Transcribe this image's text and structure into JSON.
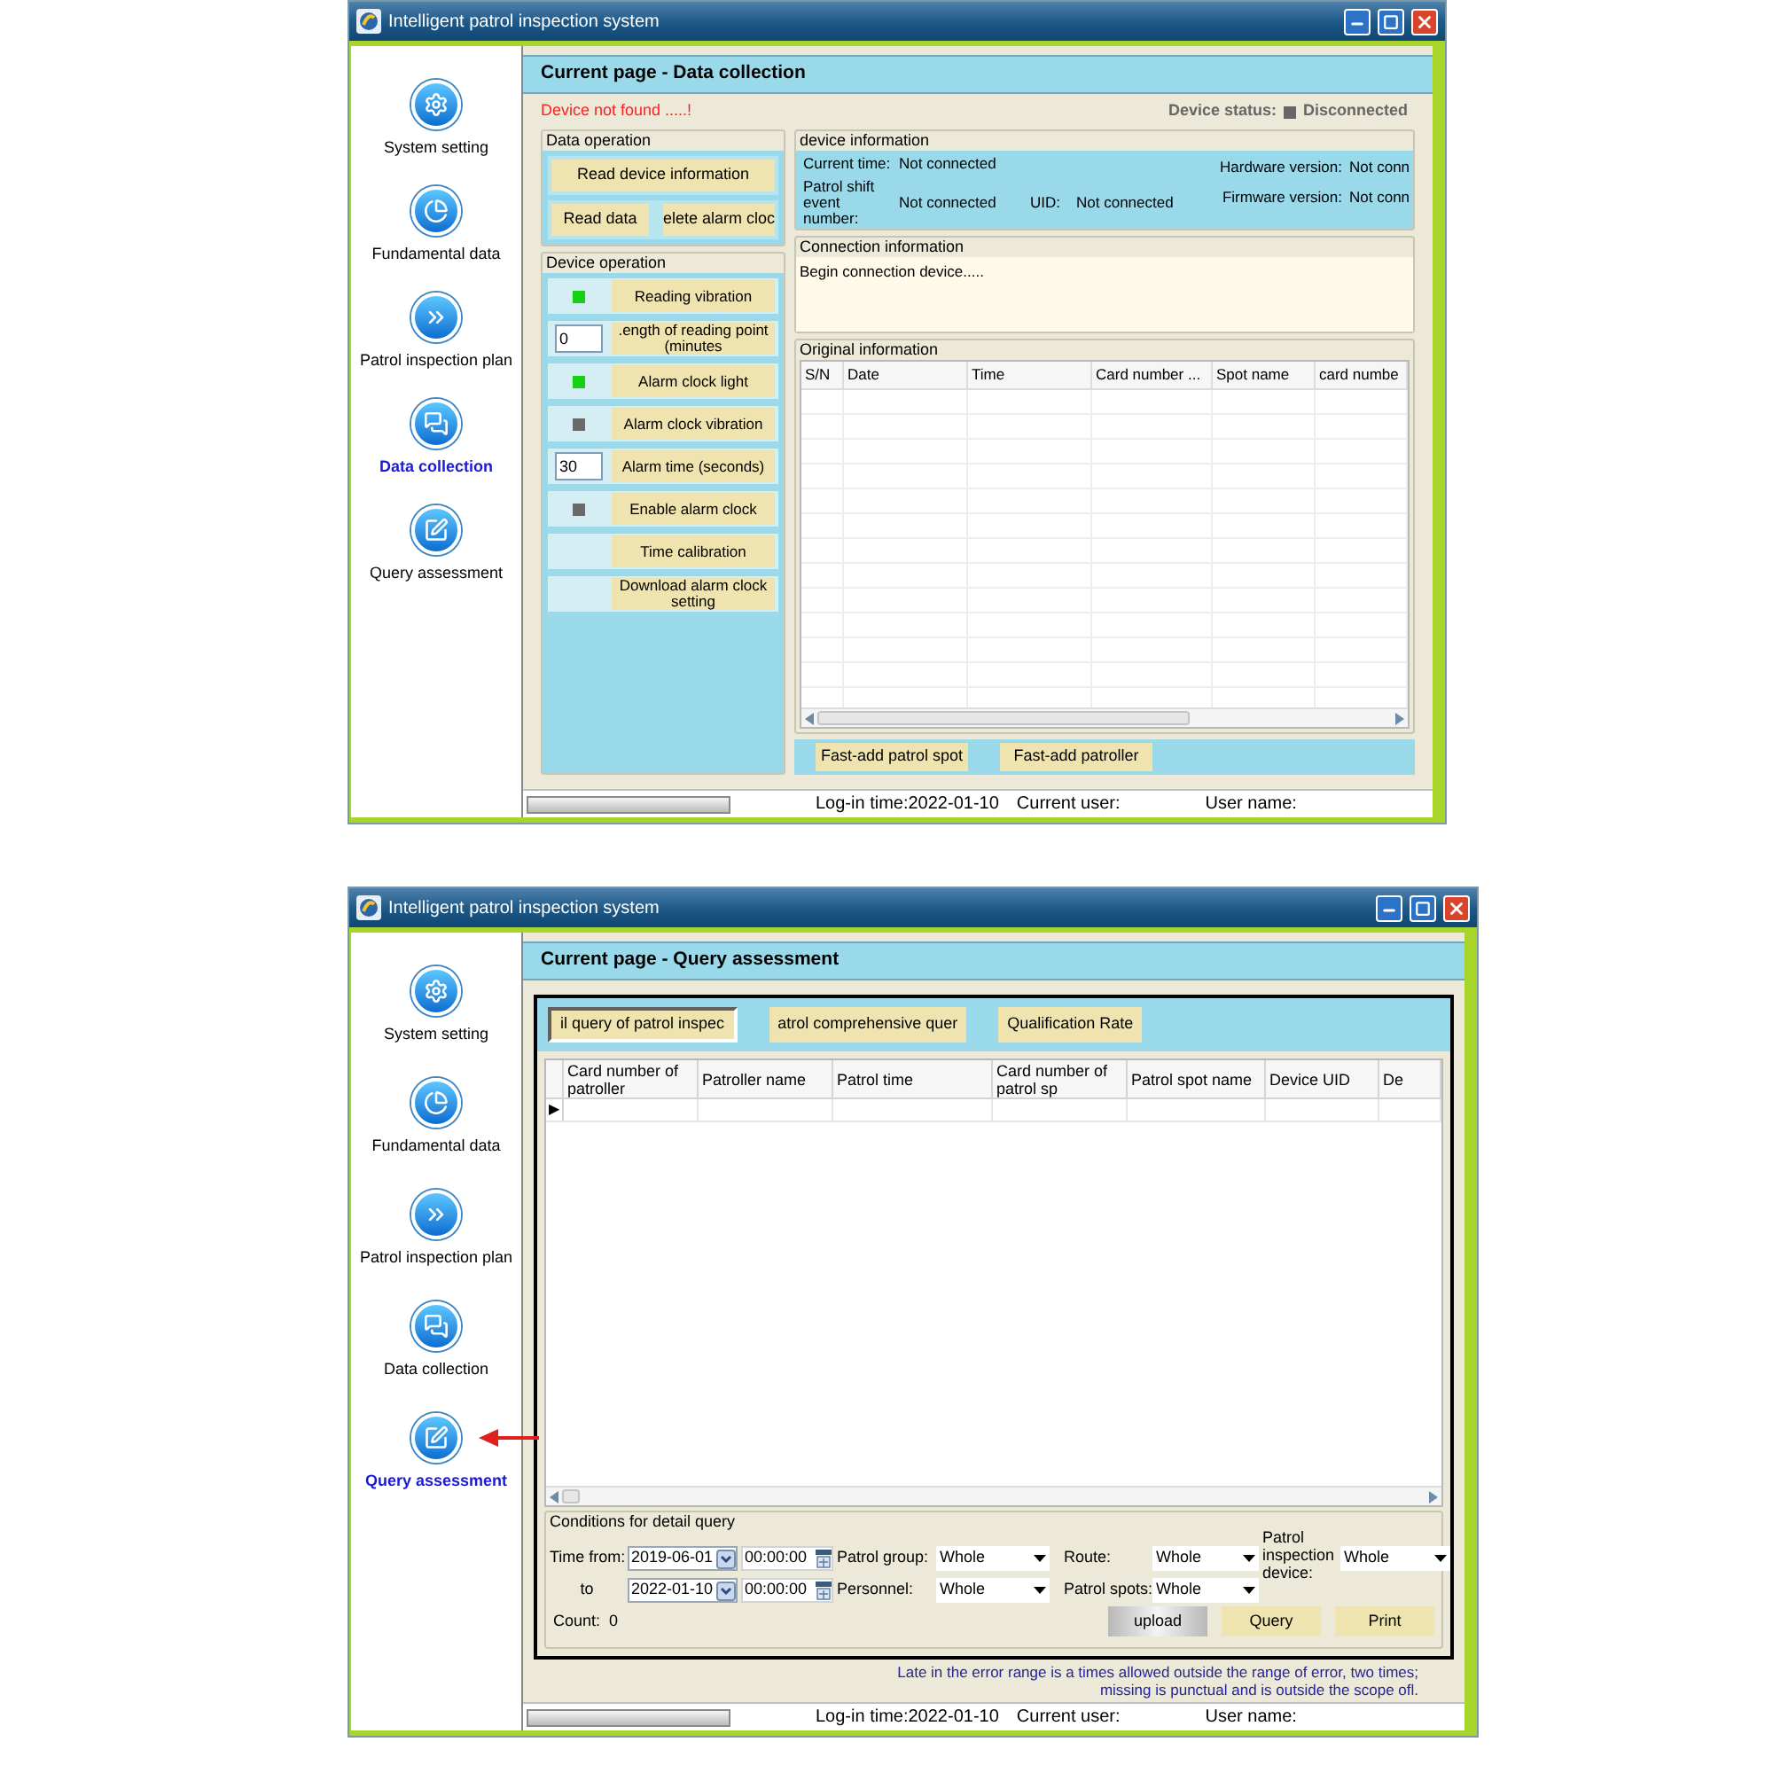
{
  "windows": [
    {
      "kind": "data_collection",
      "title": "Intelligent patrol inspection system",
      "sidebar": [
        {
          "label": "System setting",
          "selected": false,
          "marked": false
        },
        {
          "label": "Fundamental data",
          "selected": false,
          "marked": false
        },
        {
          "label": "Patrol inspection plan",
          "selected": false,
          "marked": false
        },
        {
          "label": "Data collection",
          "selected": true,
          "marked": false
        },
        {
          "label": "Query assessment",
          "selected": false,
          "marked": false
        }
      ],
      "page_title": "Current page - Data collection",
      "alert": "Device not found .....!",
      "device_status": {
        "label": "Device status:",
        "value": "Disconnected",
        "connected": false
      },
      "data_operation": {
        "title": "Data operation",
        "buttons": [
          "Read device information",
          "Read data",
          "elete alarm cloc"
        ]
      },
      "device_operation": {
        "title": "Device operation",
        "rows": [
          {
            "kind": "indicator",
            "on": true,
            "button": "Reading vibration"
          },
          {
            "kind": "input",
            "value": "0",
            "button": ".ength of reading point (minutes"
          },
          {
            "kind": "indicator",
            "on": true,
            "button": "Alarm clock light"
          },
          {
            "kind": "indicator",
            "on": false,
            "button": "Alarm clock vibration"
          },
          {
            "kind": "input",
            "value": "30",
            "button": "Alarm time (seconds)"
          },
          {
            "kind": "indicator",
            "on": false,
            "button": "Enable alarm clock"
          },
          {
            "kind": "plain",
            "button": "Time calibration"
          },
          {
            "kind": "plain",
            "button": "Download alarm clock setting"
          }
        ]
      },
      "device_information": {
        "title": "device information",
        "fields": [
          {
            "label": "Current time:",
            "value": "Not connected"
          },
          {
            "label": "Patrol shift\nevent number:",
            "value": "Not connected"
          },
          {
            "label": "UID:",
            "value": "Not connected"
          },
          {
            "label": "Hardware version:",
            "value": "Not conn"
          },
          {
            "label": "Firmware version:",
            "value": "Not conn"
          }
        ]
      },
      "connection_information": {
        "title": "Connection information",
        "log": "Begin connection device....."
      },
      "original_information": {
        "title": "Original information",
        "columns": [
          "S/N",
          "Date",
          "Time",
          "Card number ...",
          "Spot name",
          "card numbe"
        ]
      },
      "quick_buttons": [
        "Fast-add patrol spot",
        "Fast-add patroller"
      ],
      "status_bar": {
        "login_time": "Log-in time:2022-01-10",
        "current_user": "Current user:",
        "user_name": "User name:"
      }
    },
    {
      "kind": "query_assessment",
      "title": "Intelligent patrol inspection system",
      "sidebar": [
        {
          "label": "System setting",
          "selected": false,
          "marked": false
        },
        {
          "label": "Fundamental data",
          "selected": false,
          "marked": false
        },
        {
          "label": "Patrol inspection plan",
          "selected": false,
          "marked": false
        },
        {
          "label": "Data collection",
          "selected": false,
          "marked": false
        },
        {
          "label": "Query assessment",
          "selected": true,
          "marked": true
        }
      ],
      "page_title": "Current page - Query assessment",
      "tabs": [
        {
          "label": "il query of patrol inspec",
          "selected": true
        },
        {
          "label": "atrol comprehensive quer",
          "selected": false
        },
        {
          "label": "Qualification Rate",
          "selected": false
        }
      ],
      "table": {
        "columns": [
          "Card number of patroller",
          "Patroller name",
          "Patrol time",
          "Card number of patrol sp",
          "Patrol spot name",
          "Device UID",
          "De"
        ],
        "current_row_marker": "▶"
      },
      "conditions": {
        "title": "Conditions for detail query",
        "time_from": {
          "label": "Time from:",
          "date": "2019-06-01",
          "time": "00:00:00"
        },
        "time_to": {
          "label": "to",
          "date": "2022-01-10",
          "time": "00:00:00"
        },
        "filters": [
          {
            "label": "Patrol group:",
            "value": "Whole"
          },
          {
            "label": "Route:",
            "value": "Whole"
          },
          {
            "label": "Patrol inspection device:",
            "value": "Whole"
          },
          {
            "label": "Personnel:",
            "value": "Whole"
          },
          {
            "label": "Patrol spots:",
            "value": "Whole"
          }
        ],
        "count": "Count:  0",
        "buttons": [
          {
            "label": "upload",
            "kind": "gray"
          },
          {
            "label": "Query",
            "kind": "plain"
          },
          {
            "label": "Print",
            "kind": "plain"
          }
        ]
      },
      "note": "Late in the error range is a times allowed outside the range of error, two times; missing is punctual and is outside the scope ofl.",
      "status_bar": {
        "login_time": "Log-in time:2022-01-10",
        "current_user": "Current user:",
        "user_name": "User name:"
      }
    }
  ]
}
